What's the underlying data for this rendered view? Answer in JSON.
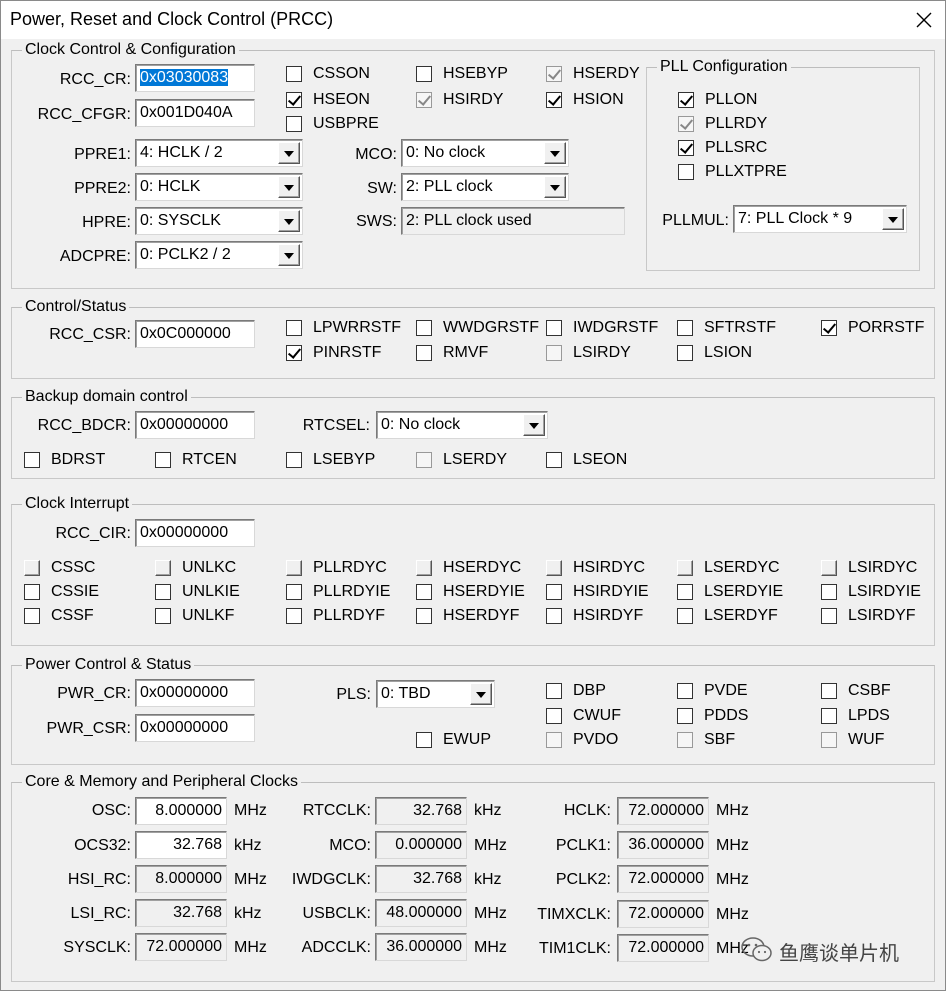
{
  "window": {
    "title": "Power, Reset and Clock Control (PRCC)"
  },
  "clock_control": {
    "legend": "Clock Control & Configuration",
    "rcc_cr_label": "RCC_CR:",
    "rcc_cr_value": "0x03030083",
    "rcc_cfgr_label": "RCC_CFGR:",
    "rcc_cfgr_value": "0x001D040A",
    "ppre1_label": "PPRE1:",
    "ppre1_value": "4: HCLK / 2",
    "ppre2_label": "PPRE2:",
    "ppre2_value": "0: HCLK",
    "hpre_label": "HPRE:",
    "hpre_value": "0: SYSCLK",
    "adcpre_label": "ADCPRE:",
    "adcpre_value": "0: PCLK2 / 2",
    "mco_label": "MCO:",
    "mco_value": "0: No clock",
    "sw_label": "SW:",
    "sw_value": "2: PLL clock",
    "sws_label": "SWS:",
    "sws_value": "2: PLL clock used",
    "checkboxes": [
      {
        "label": "CSSON",
        "checked": false,
        "disabled": false
      },
      {
        "label": "HSEBYP",
        "checked": false,
        "disabled": false
      },
      {
        "label": "HSERDY",
        "checked": true,
        "disabled": true
      },
      {
        "label": "HSEON",
        "checked": true,
        "disabled": false
      },
      {
        "label": "HSIRDY",
        "checked": true,
        "disabled": true
      },
      {
        "label": "HSION",
        "checked": true,
        "disabled": false
      },
      {
        "label": "USBPRE",
        "checked": false,
        "disabled": false
      }
    ]
  },
  "pll": {
    "legend": "PLL Configuration",
    "checkboxes": [
      {
        "label": "PLLON",
        "checked": true,
        "disabled": false
      },
      {
        "label": "PLLRDY",
        "checked": true,
        "disabled": true
      },
      {
        "label": "PLLSRC",
        "checked": true,
        "disabled": false
      },
      {
        "label": "PLLXTPRE",
        "checked": false,
        "disabled": false
      }
    ],
    "pllmul_label": "PLLMUL:",
    "pllmul_value": "7: PLL Clock * 9"
  },
  "control_status": {
    "legend": "Control/Status",
    "rcc_csr_label": "RCC_CSR:",
    "rcc_csr_value": "0x0C000000",
    "checkboxes": [
      {
        "label": "LPWRRSTF",
        "checked": false,
        "disabled": false
      },
      {
        "label": "WWDGRSTF",
        "checked": false,
        "disabled": false
      },
      {
        "label": "IWDGRSTF",
        "checked": false,
        "disabled": false
      },
      {
        "label": "SFTRSTF",
        "checked": false,
        "disabled": false
      },
      {
        "label": "PORRSTF",
        "checked": true,
        "disabled": false
      },
      {
        "label": "PINRSTF",
        "checked": true,
        "disabled": false
      },
      {
        "label": "RMVF",
        "checked": false,
        "disabled": false
      },
      {
        "label": "LSIRDY",
        "checked": false,
        "disabled": true
      },
      {
        "label": "LSION",
        "checked": false,
        "disabled": false
      }
    ]
  },
  "backup": {
    "legend": "Backup domain control",
    "rcc_bdcr_label": "RCC_BDCR:",
    "rcc_bdcr_value": "0x00000000",
    "rtcsel_label": "RTCSEL:",
    "rtcsel_value": "0: No clock",
    "checkboxes": [
      {
        "label": "BDRST",
        "checked": false,
        "disabled": false
      },
      {
        "label": "RTCEN",
        "checked": false,
        "disabled": false
      },
      {
        "label": "LSEBYP",
        "checked": false,
        "disabled": false
      },
      {
        "label": "LSERDY",
        "checked": false,
        "disabled": true
      },
      {
        "label": "LSEON",
        "checked": false,
        "disabled": false
      }
    ]
  },
  "interrupt": {
    "legend": "Clock Interrupt",
    "rcc_cir_label": "RCC_CIR:",
    "rcc_cir_value": "0x00000000",
    "rows": [
      [
        "CSSC",
        "UNLKC",
        "PLLRDYC",
        "HSERDYC",
        "HSIRDYC",
        "LSERDYC",
        "LSIRDYC"
      ],
      [
        "CSSIE",
        "UNLKIE",
        "PLLRDYIE",
        "HSERDYIE",
        "HSIRDYIE",
        "LSERDYIE",
        "LSIRDYIE"
      ],
      [
        "CSSF",
        "UNLKF",
        "PLLRDYF",
        "HSERDYF",
        "HSIRDYF",
        "LSERDYF",
        "LSIRDYF"
      ]
    ]
  },
  "power": {
    "legend": "Power Control & Status",
    "pwr_cr_label": "PWR_CR:",
    "pwr_cr_value": "0x00000000",
    "pwr_csr_label": "PWR_CSR:",
    "pwr_csr_value": "0x00000000",
    "pls_label": "PLS:",
    "pls_value": "0: TBD",
    "checkboxes": [
      {
        "label": "DBP",
        "checked": false,
        "disabled": false
      },
      {
        "label": "PVDE",
        "checked": false,
        "disabled": false
      },
      {
        "label": "CSBF",
        "checked": false,
        "disabled": false
      },
      {
        "label": "CWUF",
        "checked": false,
        "disabled": false
      },
      {
        "label": "PDDS",
        "checked": false,
        "disabled": false
      },
      {
        "label": "LPDS",
        "checked": false,
        "disabled": false
      },
      {
        "label": "EWUP",
        "checked": false,
        "disabled": false
      },
      {
        "label": "PVDO",
        "checked": false,
        "disabled": true
      },
      {
        "label": "SBF",
        "checked": false,
        "disabled": true
      },
      {
        "label": "WUF",
        "checked": false,
        "disabled": true
      }
    ]
  },
  "clocks": {
    "legend": "Core & Memory and Peripheral Clocks",
    "items": [
      {
        "label": "OSC:",
        "value": "8.000000",
        "unit": "MHz",
        "readonly": false
      },
      {
        "label": "OCS32:",
        "value": "32.768",
        "unit": "kHz",
        "readonly": false
      },
      {
        "label": "HSI_RC:",
        "value": "8.000000",
        "unit": "MHz",
        "readonly": true
      },
      {
        "label": "LSI_RC:",
        "value": "32.768",
        "unit": "kHz",
        "readonly": true
      },
      {
        "label": "SYSCLK:",
        "value": "72.000000",
        "unit": "MHz",
        "readonly": true
      },
      {
        "label": "RTCCLK:",
        "value": "32.768",
        "unit": "kHz",
        "readonly": true
      },
      {
        "label": "MCO:",
        "value": "0.000000",
        "unit": "MHz",
        "readonly": true
      },
      {
        "label": "IWDGCLK:",
        "value": "32.768",
        "unit": "kHz",
        "readonly": true
      },
      {
        "label": "USBCLK:",
        "value": "48.000000",
        "unit": "MHz",
        "readonly": true
      },
      {
        "label": "ADCCLK:",
        "value": "36.000000",
        "unit": "MHz",
        "readonly": true
      },
      {
        "label": "HCLK:",
        "value": "72.000000",
        "unit": "MHz",
        "readonly": true
      },
      {
        "label": "PCLK1:",
        "value": "36.000000",
        "unit": "MHz",
        "readonly": true
      },
      {
        "label": "PCLK2:",
        "value": "72.000000",
        "unit": "MHz",
        "readonly": true
      },
      {
        "label": "TIMXCLK:",
        "value": "72.000000",
        "unit": "MHz",
        "readonly": true
      },
      {
        "label": "TIM1CLK:",
        "value": "72.000000",
        "unit": "MHz",
        "readonly": true
      }
    ]
  },
  "watermark": {
    "text": "鱼鹰谈单片机",
    "icon": "wechat-icon"
  }
}
